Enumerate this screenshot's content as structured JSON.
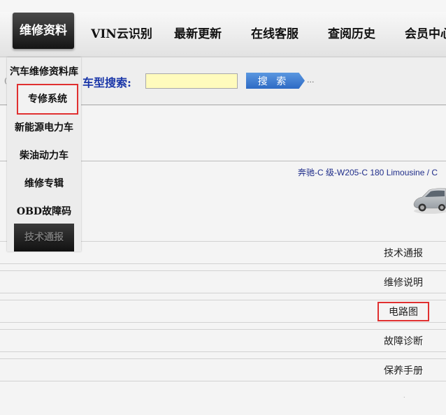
{
  "nav": {
    "items": [
      {
        "label": "维修资料",
        "active": true
      },
      {
        "label": "VIN云识别"
      },
      {
        "label": "最新更新"
      },
      {
        "label": "在线客服"
      },
      {
        "label": "查阅历史"
      },
      {
        "label": "会员中心"
      }
    ]
  },
  "search": {
    "label": "车型搜索:",
    "input_value": "",
    "button_label": "搜 索",
    "more": "..."
  },
  "dropdown": {
    "overflow_char": "(",
    "items": [
      {
        "label": "汽车维修资料库"
      },
      {
        "label": "专修系统",
        "highlighted": true
      },
      {
        "label": "新能源电力车"
      },
      {
        "label": "柴油动力车"
      },
      {
        "label": "维修专辑"
      },
      {
        "label": "OBD故障码"
      },
      {
        "label": "技术通报",
        "dark": true
      }
    ]
  },
  "breadcrumb": "奔驰-C 级-W205-C 180 Limousine / C",
  "list": {
    "rows": [
      {
        "label": "技术通报"
      },
      {
        "label": "维修说明"
      },
      {
        "label": "电路图",
        "highlighted": true
      },
      {
        "label": "故障诊断"
      },
      {
        "label": "保养手册"
      }
    ]
  },
  "footer_dot": "."
}
